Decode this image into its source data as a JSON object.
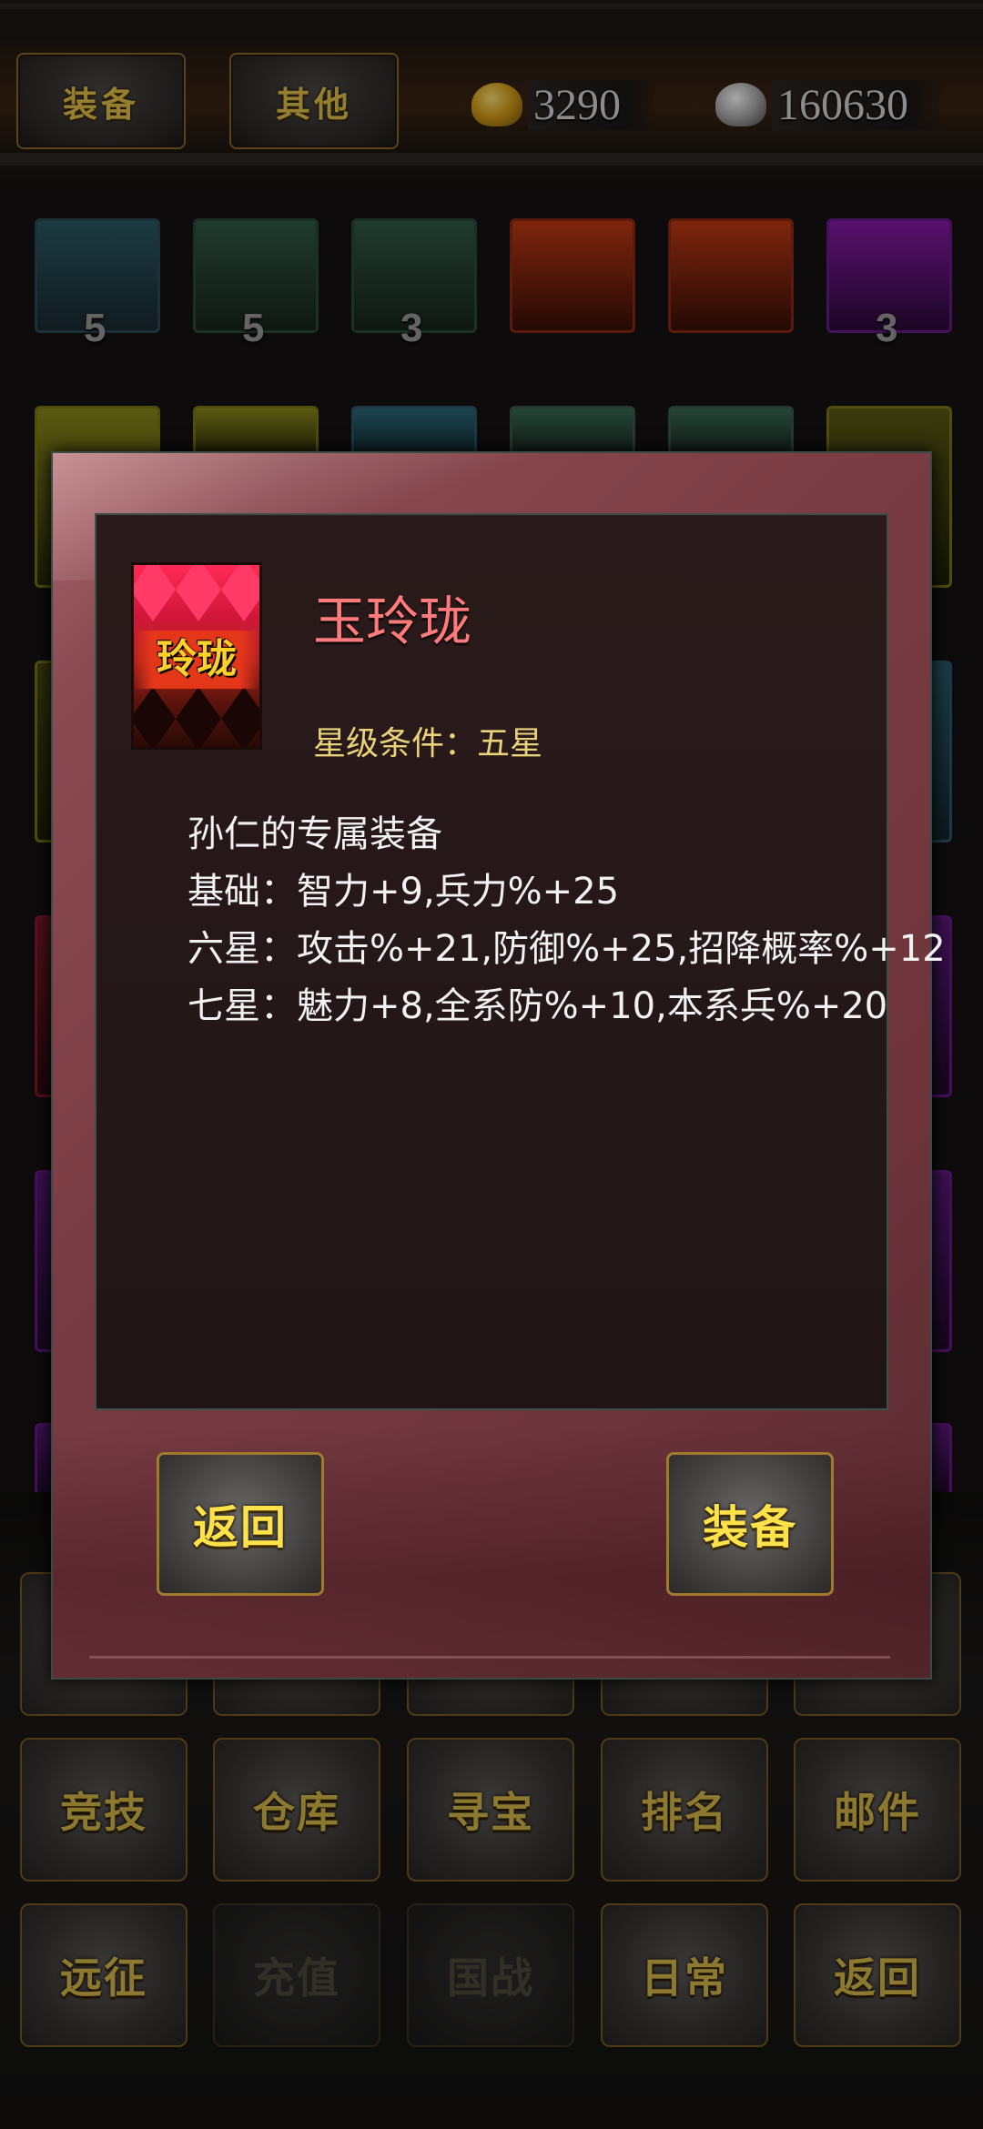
{
  "header": {
    "tab_equipment": "装备",
    "tab_other": "其他",
    "gold_amount": "3290",
    "silver_amount": "160630"
  },
  "inventory": {
    "counts": [
      "5",
      "5",
      "3",
      "3"
    ]
  },
  "dialog": {
    "item_icon_label": "玲珑",
    "item_name": "玉玲珑",
    "star_requirement": "星级条件：五星",
    "description_lines": [
      "孙仁的专属装备",
      "基础：智力+9,兵力%+25",
      "六星：攻击%+21,防御%+25,招降概率%+12",
      "七星：魅力+8,全系防%+10,本系兵%+20"
    ],
    "back_button": "返回",
    "equip_button": "装备"
  },
  "menu": {
    "row2": [
      "竞技",
      "仓库",
      "寻宝",
      "排名",
      "邮件"
    ],
    "row3": [
      "远征",
      "充值",
      "国战",
      "日常",
      "返回"
    ]
  },
  "colors": {
    "item_name": "#ff7a7a",
    "star_requirement": "#ead27a",
    "button_text": "#e6c24a",
    "dialog_frame": "#8a4a52"
  }
}
